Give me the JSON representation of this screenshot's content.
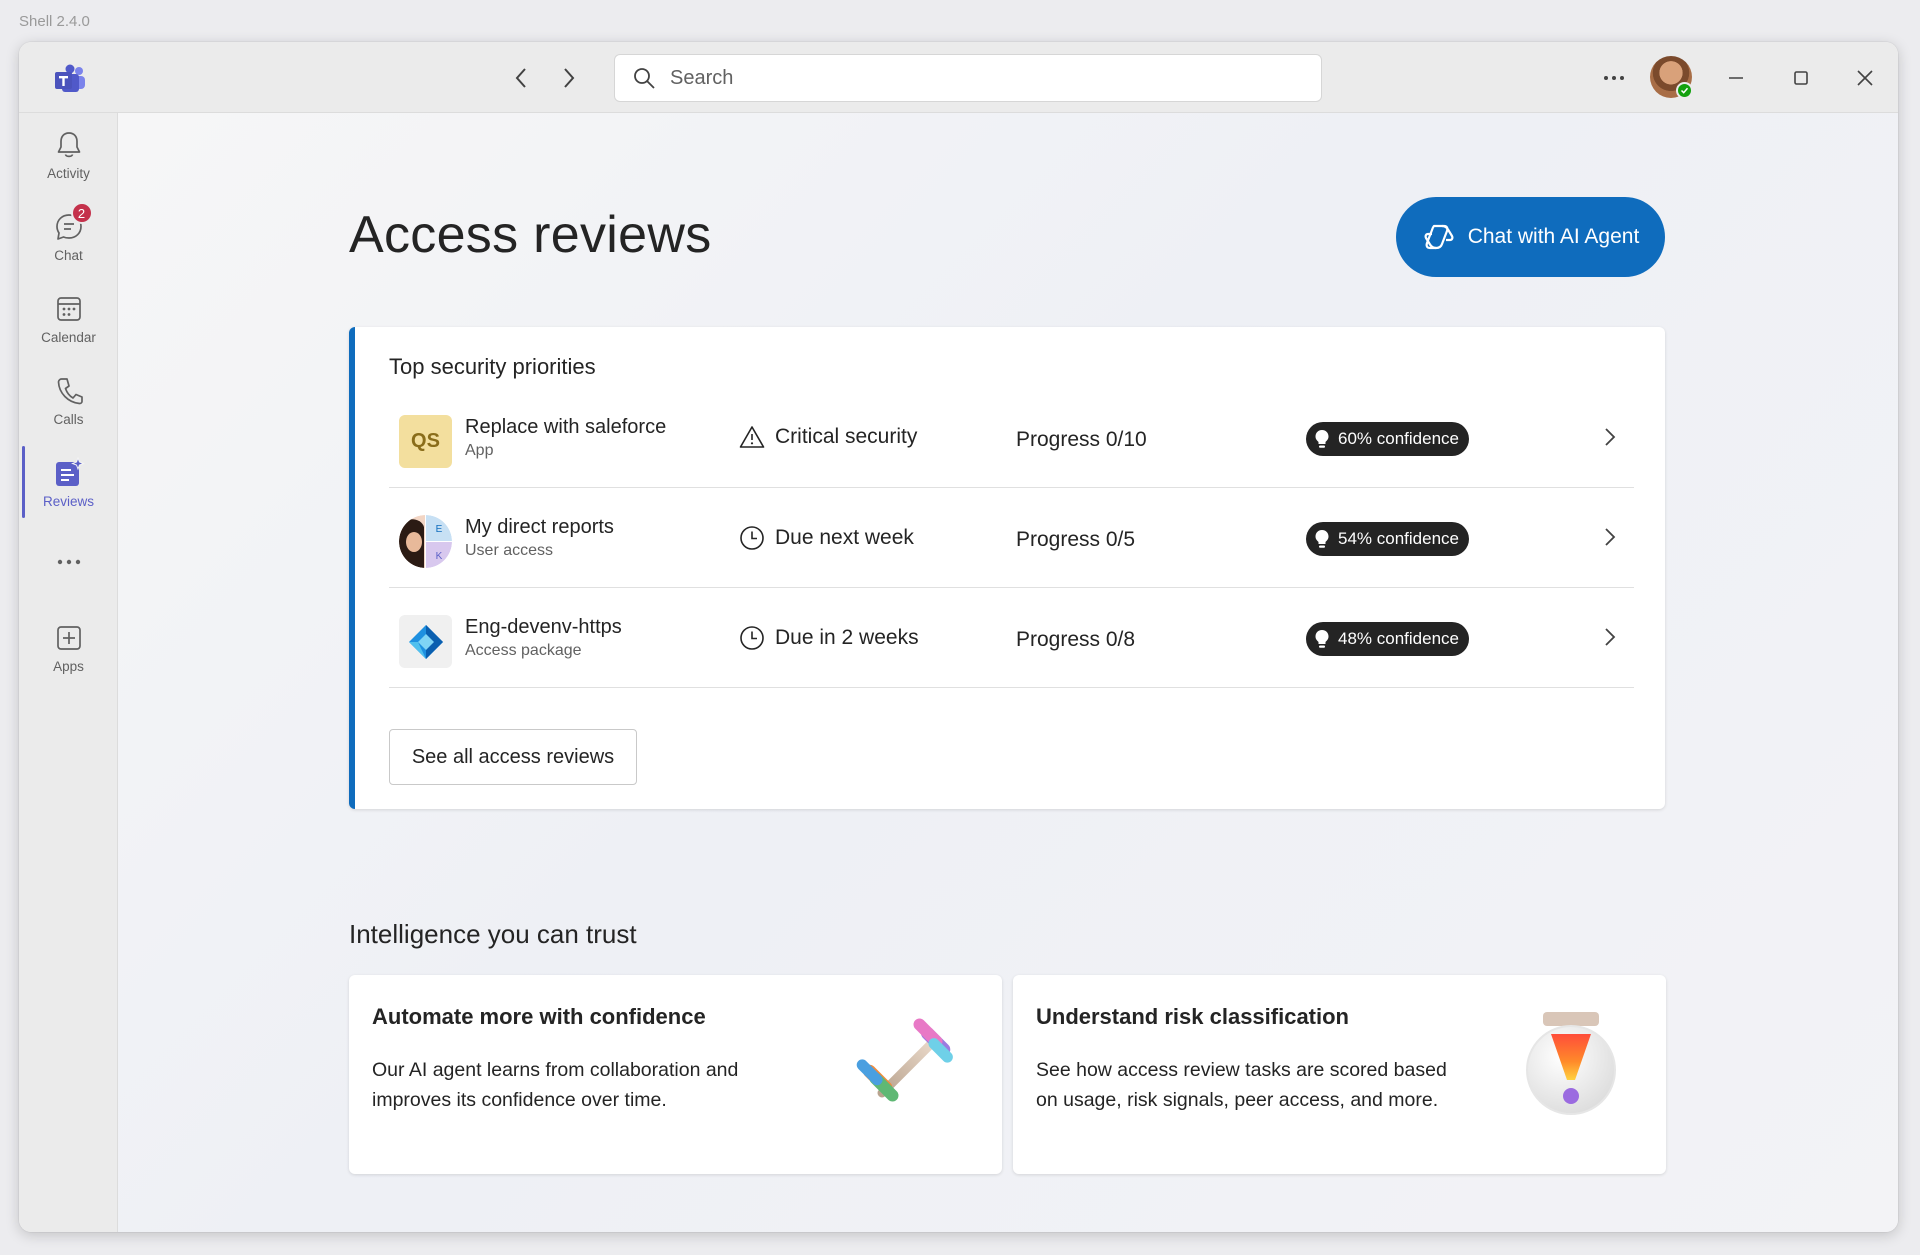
{
  "shell": {
    "version": "Shell 2.4.0"
  },
  "titlebar": {
    "search_placeholder": "Search",
    "icons": {
      "app_logo": "teams-logo-icon",
      "back": "chevron-left-icon",
      "forward": "chevron-right-icon",
      "search": "search-icon",
      "more": "more-horizontal-icon",
      "minimize": "minimize-icon",
      "maximize": "maximize-icon",
      "close": "close-icon"
    }
  },
  "rail": {
    "items": [
      {
        "label": "Activity",
        "icon": "bell-icon"
      },
      {
        "label": "Chat",
        "icon": "chat-icon",
        "badge": "2"
      },
      {
        "label": "Calendar",
        "icon": "calendar-icon"
      },
      {
        "label": "Calls",
        "icon": "phone-icon"
      },
      {
        "label": "Reviews",
        "icon": "reviews-icon",
        "active": true
      },
      {
        "label": "",
        "icon": "more-horizontal-icon"
      },
      {
        "label": "Apps",
        "icon": "add-app-icon"
      }
    ]
  },
  "main": {
    "title": "Access reviews",
    "ai_button_label": "Chat with AI Agent",
    "priorities": {
      "heading": "Top security priorities",
      "rows": [
        {
          "icon_text": "QS",
          "title": "Replace with saleforce",
          "subtitle": "App",
          "status_icon": "warning-icon",
          "status": "Critical security",
          "progress": "Progress 0/10",
          "confidence": "60% confidence"
        },
        {
          "icon_text": "",
          "avatar_initials": [
            "E",
            "K"
          ],
          "title": "My direct reports",
          "subtitle": "User access",
          "status_icon": "clock-icon",
          "status": "Due next week",
          "progress": "Progress 0/5",
          "confidence": "54% confidence"
        },
        {
          "icon_text": "",
          "title": "Eng-devenv-https",
          "subtitle": "Access package",
          "status_icon": "clock-icon",
          "status": "Due in 2 weeks",
          "progress": "Progress 0/8",
          "confidence": "48% confidence"
        }
      ],
      "see_all_label": "See all access reviews"
    },
    "intelligence": {
      "heading": "Intelligence you can trust",
      "cards": [
        {
          "title": "Automate more with confidence",
          "body": "Our AI agent learns from collaboration and improves its confidence over time.",
          "art": "dumbbell-illustration"
        },
        {
          "title": "Understand risk classification",
          "body": "See how access review tasks are scored based on usage, risk signals, peer access, and more.",
          "art": "alert-badge-illustration"
        }
      ]
    }
  },
  "colors": {
    "accent": "#0f6cbd",
    "rail_active": "#5b5fc7",
    "badge": "#c4314b",
    "presence": "#13a10e",
    "confidence_pill": "#242424"
  }
}
